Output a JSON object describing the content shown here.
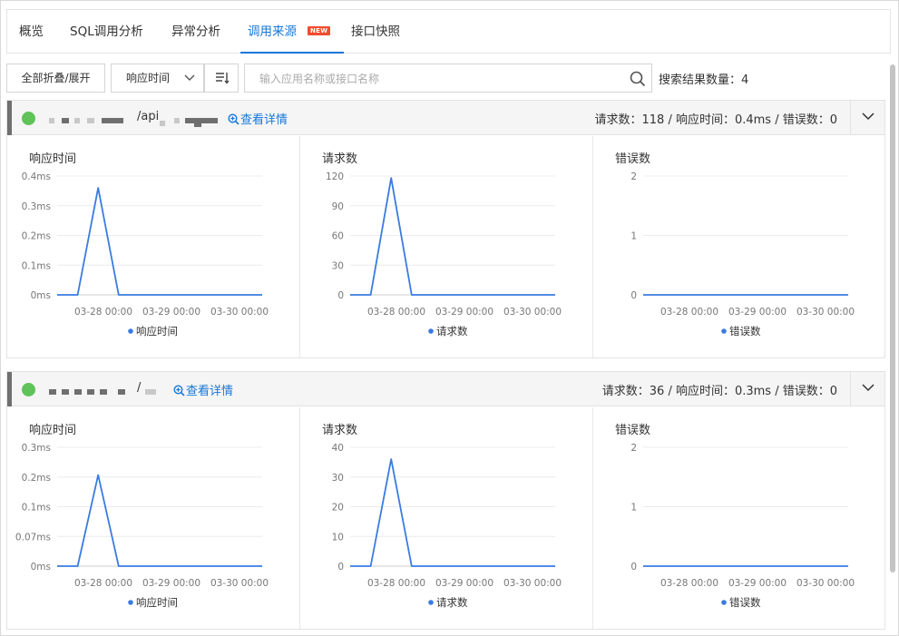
{
  "tabs": [
    {
      "label": "概览"
    },
    {
      "label": "SQL调用分析"
    },
    {
      "label": "异常分析"
    },
    {
      "label": "调用来源",
      "badge": "NEW",
      "active": true
    },
    {
      "label": "接口快照"
    }
  ],
  "toolbar": {
    "collapse_label": "全部折叠/展开",
    "sort_select": "响应时间",
    "search_placeholder": "输入应用名称或接口名称",
    "result_count_label": "搜索结果数量：4"
  },
  "colors": {
    "accent": "#1677d9",
    "status_ok": "#5fc35a",
    "line": "#3a7be0",
    "badge": "#f14c2f"
  },
  "x_tick_labels": [
    "03-28 00:00",
    "03-29 00:00",
    "03-30 00:00"
  ],
  "cards": [
    {
      "path_label": "/api",
      "detail_link": "查看详情",
      "summary": "请求数：118 / 响应时间：0.4ms / 错误数：0",
      "charts": [
        {
          "title": "响应时间",
          "legend": "响应时间",
          "yticks": [
            "0ms",
            "0.1ms",
            "0.2ms",
            "0.3ms",
            "0.4ms"
          ],
          "ymax": 0.4
        },
        {
          "title": "请求数",
          "legend": "请求数",
          "yticks": [
            "0",
            "30",
            "60",
            "90",
            "120"
          ],
          "ymax": 120
        },
        {
          "title": "错误数",
          "legend": "错误数",
          "yticks": [
            "0",
            "1",
            "2"
          ],
          "ymax": 2
        }
      ]
    },
    {
      "path_label": "/",
      "detail_link": "查看详情",
      "summary": "请求数：36 / 响应时间：0.3ms / 错误数：0",
      "charts": [
        {
          "title": "响应时间",
          "legend": "响应时间",
          "yticks": [
            "0ms",
            "0.07ms",
            "0.1ms",
            "0.2ms",
            "0.3ms"
          ],
          "ymax": 0.3
        },
        {
          "title": "请求数",
          "legend": "请求数",
          "yticks": [
            "0",
            "10",
            "20",
            "30",
            "40"
          ],
          "ymax": 40
        },
        {
          "title": "错误数",
          "legend": "错误数",
          "yticks": [
            "0",
            "1",
            "2"
          ],
          "ymax": 2
        }
      ]
    }
  ],
  "chart_data": [
    {
      "type": "line",
      "title": "响应时间",
      "x": [
        "03-28 00:00",
        "03-29 00:00",
        "03-30 00:00"
      ],
      "series": [
        {
          "name": "响应时间",
          "values": [
            0,
            0,
            0.36,
            0,
            0,
            0,
            0,
            0,
            0,
            0,
            0
          ]
        }
      ],
      "ylim": [
        0,
        0.4
      ]
    },
    {
      "type": "line",
      "title": "请求数",
      "x": [
        "03-28 00:00",
        "03-29 00:00",
        "03-30 00:00"
      ],
      "series": [
        {
          "name": "请求数",
          "values": [
            0,
            0,
            118,
            0,
            0,
            0,
            0,
            0,
            0,
            0,
            0
          ]
        }
      ],
      "ylim": [
        0,
        120
      ]
    },
    {
      "type": "line",
      "title": "错误数",
      "x": [
        "03-28 00:00",
        "03-29 00:00",
        "03-30 00:00"
      ],
      "series": [
        {
          "name": "错误数",
          "values": [
            0,
            0,
            0,
            0,
            0,
            0,
            0,
            0,
            0,
            0,
            0
          ]
        }
      ],
      "ylim": [
        0,
        2
      ]
    },
    {
      "type": "line",
      "title": "响应时间",
      "x": [
        "03-28 00:00",
        "03-29 00:00",
        "03-30 00:00"
      ],
      "series": [
        {
          "name": "响应时间",
          "values": [
            0,
            0,
            0.23,
            0,
            0,
            0,
            0,
            0,
            0,
            0,
            0
          ]
        }
      ],
      "ylim": [
        0,
        0.3
      ]
    },
    {
      "type": "line",
      "title": "请求数",
      "x": [
        "03-28 00:00",
        "03-29 00:00",
        "03-30 00:00"
      ],
      "series": [
        {
          "name": "请求数",
          "values": [
            0,
            0,
            36,
            0,
            0,
            0,
            0,
            0,
            0,
            0,
            0
          ]
        }
      ],
      "ylim": [
        0,
        40
      ]
    },
    {
      "type": "line",
      "title": "错误数",
      "x": [
        "03-28 00:00",
        "03-29 00:00",
        "03-30 00:00"
      ],
      "series": [
        {
          "name": "错误数",
          "values": [
            0,
            0,
            0,
            0,
            0,
            0,
            0,
            0,
            0,
            0,
            0
          ]
        }
      ],
      "ylim": [
        0,
        2
      ]
    }
  ]
}
